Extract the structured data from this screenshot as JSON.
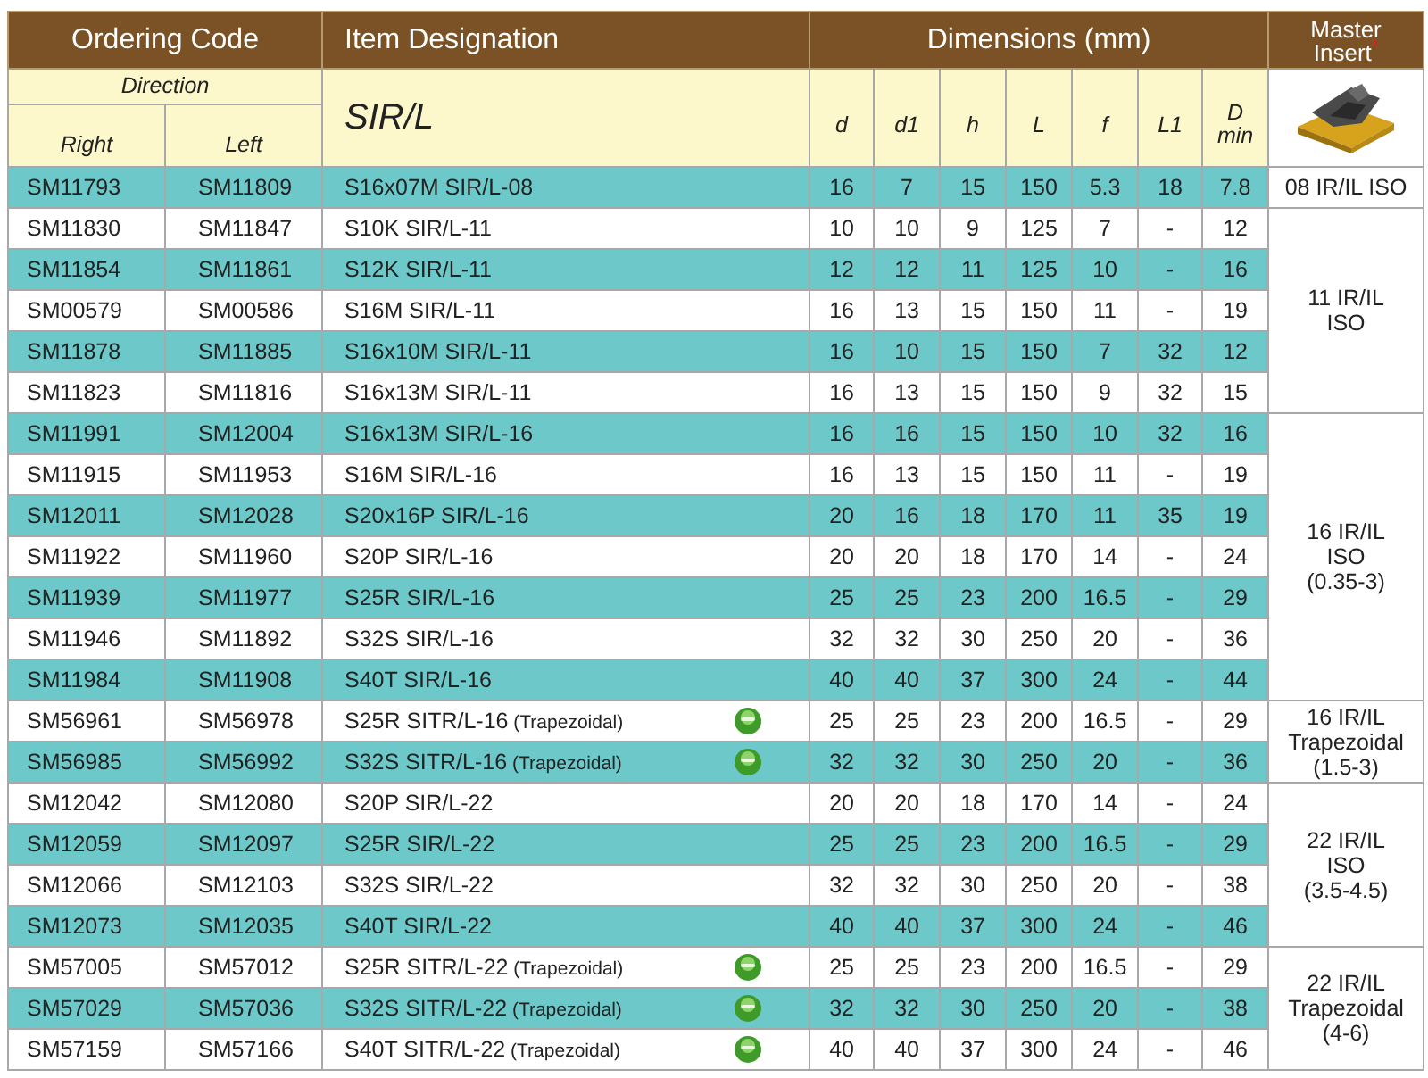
{
  "header": {
    "ordering_code": "Ordering Code",
    "item_designation": "Item Designation",
    "dimensions": "Dimensions (mm)",
    "master_insert": "Master Insert",
    "master_insert_mark": "*"
  },
  "subheader": {
    "direction": "Direction",
    "right": "Right",
    "left": "Left",
    "designation": "SIR/L",
    "columns": [
      "d",
      "d1",
      "h",
      "L",
      "f",
      "L1",
      "D min"
    ]
  },
  "groups": [
    {
      "insert_lines": [
        "08 IR/IL ISO"
      ],
      "rows": [
        {
          "right": "SM11793",
          "left": "SM11809",
          "designation": "S16x07M SIR/L-08",
          "badge": false,
          "shaded": true,
          "values": [
            "16",
            "7",
            "15",
            "150",
            "5.3",
            "18",
            "7.8"
          ]
        }
      ]
    },
    {
      "insert_lines": [
        "11 IR/IL",
        "ISO"
      ],
      "rows": [
        {
          "right": "SM11830",
          "left": "SM11847",
          "designation": "S10K SIR/L-11",
          "badge": false,
          "shaded": false,
          "values": [
            "10",
            "10",
            "9",
            "125",
            "7",
            "-",
            "12"
          ]
        },
        {
          "right": "SM11854",
          "left": "SM11861",
          "designation": "S12K SIR/L-11",
          "badge": false,
          "shaded": true,
          "values": [
            "12",
            "12",
            "11",
            "125",
            "10",
            "-",
            "16"
          ]
        },
        {
          "right": "SM00579",
          "left": "SM00586",
          "designation": "S16M SIR/L-11",
          "badge": false,
          "shaded": false,
          "values": [
            "16",
            "13",
            "15",
            "150",
            "11",
            "-",
            "19"
          ]
        },
        {
          "right": "SM11878",
          "left": "SM11885",
          "designation": "S16x10M SIR/L-11",
          "badge": false,
          "shaded": true,
          "values": [
            "16",
            "10",
            "15",
            "150",
            "7",
            "32",
            "12"
          ]
        },
        {
          "right": "SM11823",
          "left": "SM11816",
          "designation": "S16x13M SIR/L-11",
          "badge": false,
          "shaded": false,
          "values": [
            "16",
            "13",
            "15",
            "150",
            "9",
            "32",
            "15"
          ]
        }
      ]
    },
    {
      "insert_lines": [
        "16 IR/IL",
        "ISO",
        "(0.35-3)"
      ],
      "rows": [
        {
          "right": "SM11991",
          "left": "SM12004",
          "designation": "S16x13M SIR/L-16",
          "badge": false,
          "shaded": true,
          "values": [
            "16",
            "16",
            "15",
            "150",
            "10",
            "32",
            "16"
          ]
        },
        {
          "right": "SM11915",
          "left": "SM11953",
          "designation": "S16M SIR/L-16",
          "badge": false,
          "shaded": false,
          "values": [
            "16",
            "13",
            "15",
            "150",
            "11",
            "-",
            "19"
          ]
        },
        {
          "right": "SM12011",
          "left": "SM12028",
          "designation": "S20x16P SIR/L-16",
          "badge": false,
          "shaded": true,
          "values": [
            "20",
            "16",
            "18",
            "170",
            "11",
            "35",
            "19"
          ]
        },
        {
          "right": "SM11922",
          "left": "SM11960",
          "designation": "S20P SIR/L-16",
          "badge": false,
          "shaded": false,
          "values": [
            "20",
            "20",
            "18",
            "170",
            "14",
            "-",
            "24"
          ]
        },
        {
          "right": "SM11939",
          "left": "SM11977",
          "designation": "S25R SIR/L-16",
          "badge": false,
          "shaded": true,
          "values": [
            "25",
            "25",
            "23",
            "200",
            "16.5",
            "-",
            "29"
          ]
        },
        {
          "right": "SM11946",
          "left": "SM11892",
          "designation": "S32S SIR/L-16",
          "badge": false,
          "shaded": false,
          "values": [
            "32",
            "32",
            "30",
            "250",
            "20",
            "-",
            "36"
          ]
        },
        {
          "right": "SM11984",
          "left": "SM11908",
          "designation": "S40T SIR/L-16",
          "badge": false,
          "shaded": true,
          "values": [
            "40",
            "40",
            "37",
            "300",
            "24",
            "-",
            "44"
          ]
        }
      ]
    },
    {
      "insert_lines": [
        "16 IR/IL",
        "Trapezoidal",
        "(1.5-3)"
      ],
      "rows": [
        {
          "right": "SM56961",
          "left": "SM56978",
          "designation": "S25R SITR/L-16",
          "note": "(Trapezoidal)",
          "badge": true,
          "shaded": false,
          "values": [
            "25",
            "25",
            "23",
            "200",
            "16.5",
            "-",
            "29"
          ]
        },
        {
          "right": "SM56985",
          "left": "SM56992",
          "designation": "S32S SITR/L-16",
          "note": "(Trapezoidal)",
          "badge": true,
          "shaded": true,
          "values": [
            "32",
            "32",
            "30",
            "250",
            "20",
            "-",
            "36"
          ]
        }
      ]
    },
    {
      "insert_lines": [
        "22 IR/IL",
        "ISO",
        "(3.5-4.5)"
      ],
      "rows": [
        {
          "right": "SM12042",
          "left": "SM12080",
          "designation": "S20P SIR/L-22",
          "badge": false,
          "shaded": false,
          "values": [
            "20",
            "20",
            "18",
            "170",
            "14",
            "-",
            "24"
          ]
        },
        {
          "right": "SM12059",
          "left": "SM12097",
          "designation": "S25R SIR/L-22",
          "badge": false,
          "shaded": true,
          "values": [
            "25",
            "25",
            "23",
            "200",
            "16.5",
            "-",
            "29"
          ]
        },
        {
          "right": "SM12066",
          "left": "SM12103",
          "designation": "S32S SIR/L-22",
          "badge": false,
          "shaded": false,
          "values": [
            "32",
            "32",
            "30",
            "250",
            "20",
            "-",
            "38"
          ]
        },
        {
          "right": "SM12073",
          "left": "SM12035",
          "designation": "S40T SIR/L-22",
          "badge": false,
          "shaded": true,
          "values": [
            "40",
            "40",
            "37",
            "300",
            "24",
            "-",
            "46"
          ]
        }
      ]
    },
    {
      "insert_lines": [
        "22 IR/IL",
        "Trapezoidal",
        "(4-6)"
      ],
      "rows": [
        {
          "right": "SM57005",
          "left": "SM57012",
          "designation": "S25R SITR/L-22",
          "note": "(Trapezoidal)",
          "badge": true,
          "shaded": false,
          "values": [
            "25",
            "25",
            "23",
            "200",
            "16.5",
            "-",
            "29"
          ]
        },
        {
          "right": "SM57029",
          "left": "SM57036",
          "designation": "S32S SITR/L-22",
          "note": "(Trapezoidal)",
          "badge": true,
          "shaded": true,
          "values": [
            "32",
            "32",
            "30",
            "250",
            "20",
            "-",
            "38"
          ]
        },
        {
          "right": "SM57159",
          "left": "SM57166",
          "designation": "S40T SITR/L-22",
          "note": "(Trapezoidal)",
          "badge": true,
          "shaded": false,
          "values": [
            "40",
            "40",
            "37",
            "300",
            "24",
            "-",
            "46"
          ]
        }
      ]
    }
  ]
}
